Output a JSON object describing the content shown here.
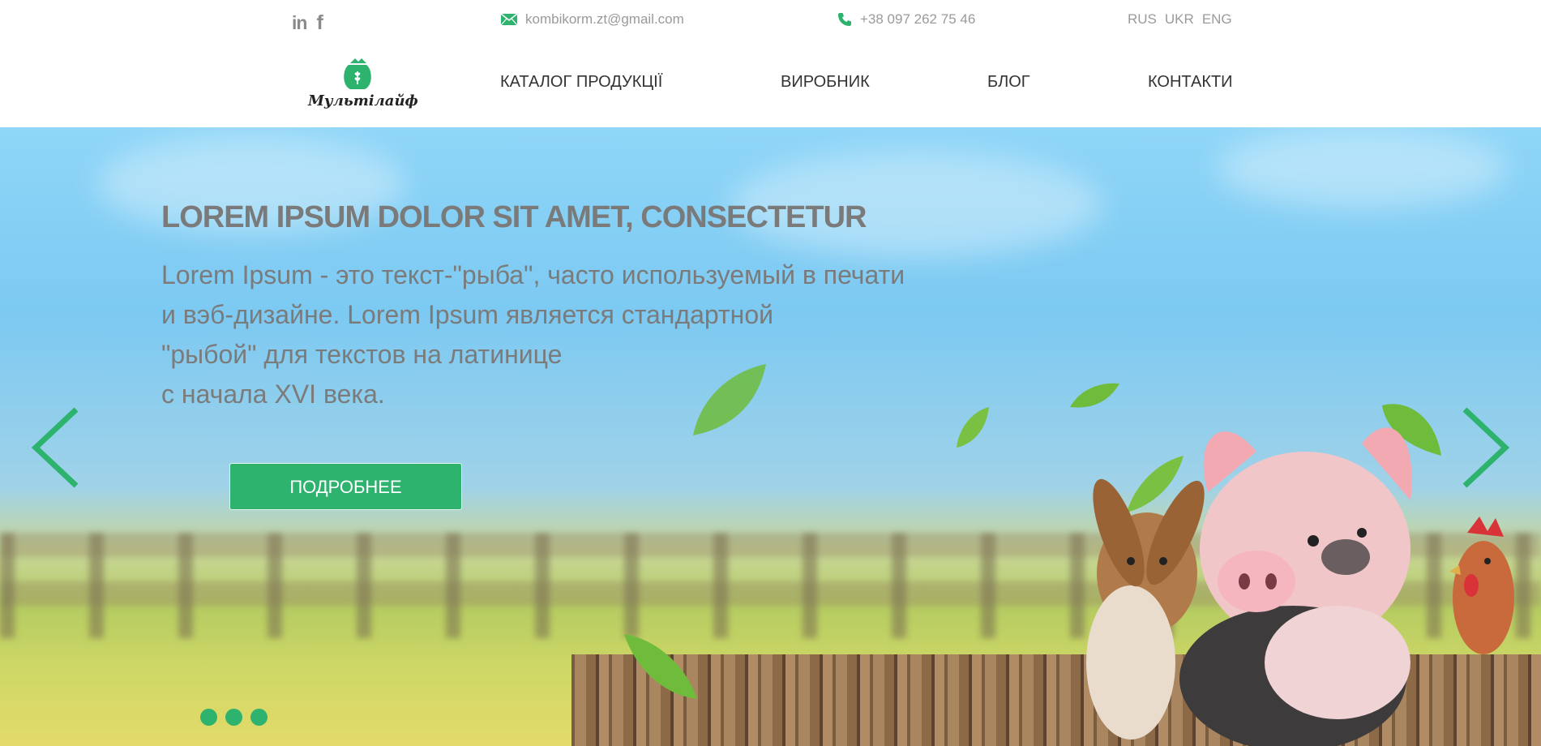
{
  "topbar": {
    "social": [
      {
        "icon": "linkedin-icon",
        "glyph": "in"
      },
      {
        "icon": "facebook-icon",
        "glyph": "f"
      }
    ],
    "email": "kombikorm.zt@gmail.com",
    "phone": "+38 097 262 75 46",
    "languages": [
      "RUS",
      "UKR",
      "ENG"
    ]
  },
  "logo": {
    "text": "Мультілайф",
    "icon": "sack-logo-icon"
  },
  "nav": {
    "items": [
      "КАТАЛОГ ПРОДУКЦІЇ",
      "ВИРОБНИК",
      "БЛОГ",
      "КОНТАКТИ"
    ]
  },
  "hero": {
    "title": "LOREM IPSUM DOLOR SIT AMET, CONSECTETUR",
    "text_lines": [
      "Lorem Ipsum - это текст-\"рыба\", часто используемый в печати",
      "и вэб-дизайне. Lorem Ipsum является стандартной",
      "\"рыбой\" для текстов на латинице",
      "с начала XVI века."
    ],
    "button_label": "ПОДРОБНЕЕ",
    "slides_count": 3
  },
  "colors": {
    "accent": "#2db36e",
    "text_gray": "#7b7b7b",
    "topbar_gray": "#9a9a9a"
  }
}
